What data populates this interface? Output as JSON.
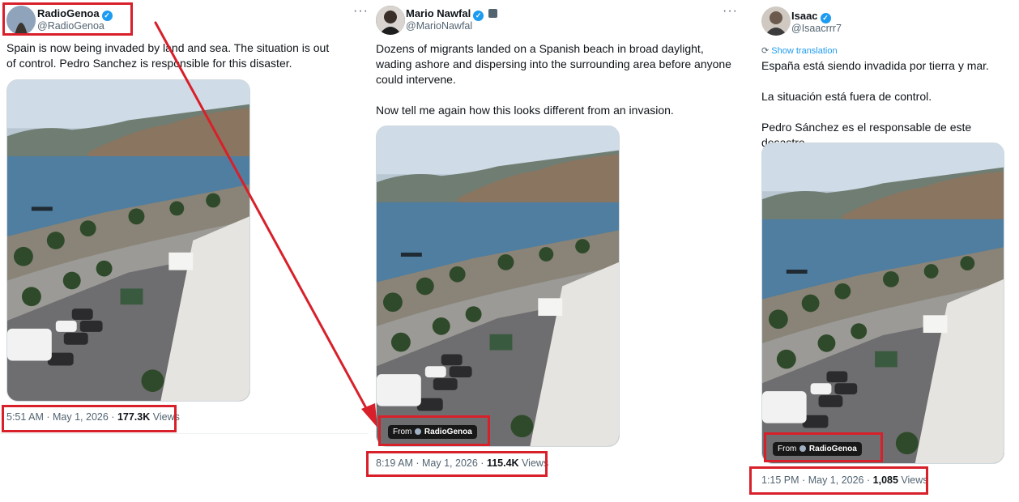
{
  "tweets": [
    {
      "name": "RadioGenoa",
      "handle": "@RadioGenoa",
      "text": [
        "Spain is now being invaded by land and sea. The situation is out of control. Pedro Sanchez is responsible for this disaster."
      ],
      "time": "5:51 AM",
      "date": "May 1, 2026",
      "views_count": "177.3K",
      "views_label": "Views"
    },
    {
      "name": "Mario Nawfal",
      "handle": "@MarioNawfal",
      "text": [
        "Dozens of migrants landed on a Spanish beach in broad daylight, wading ashore and dispersing into the surrounding area before anyone could intervene.",
        "Now tell me again how this looks different from an invasion."
      ],
      "time": "8:19 AM",
      "date": "May 1, 2026",
      "views_count": "115.4K",
      "views_label": "Views",
      "from_label": "From",
      "from_source": "RadioGenoa"
    },
    {
      "name": "Isaac",
      "handle": "@Isaacrrr7",
      "translate_label": "Show translation",
      "text": [
        "España está siendo invadida por tierra y mar.",
        "La situación está fuera de control.",
        "Pedro Sánchez es el responsable de este desastre."
      ],
      "time": "1:15 PM",
      "date": "May 1, 2026",
      "views_count": "1,085",
      "views_label": "Views",
      "from_label": "From",
      "from_source": "RadioGenoa"
    }
  ],
  "separator": "·",
  "more_glyph": "···",
  "annotation_color": "#d8202a"
}
